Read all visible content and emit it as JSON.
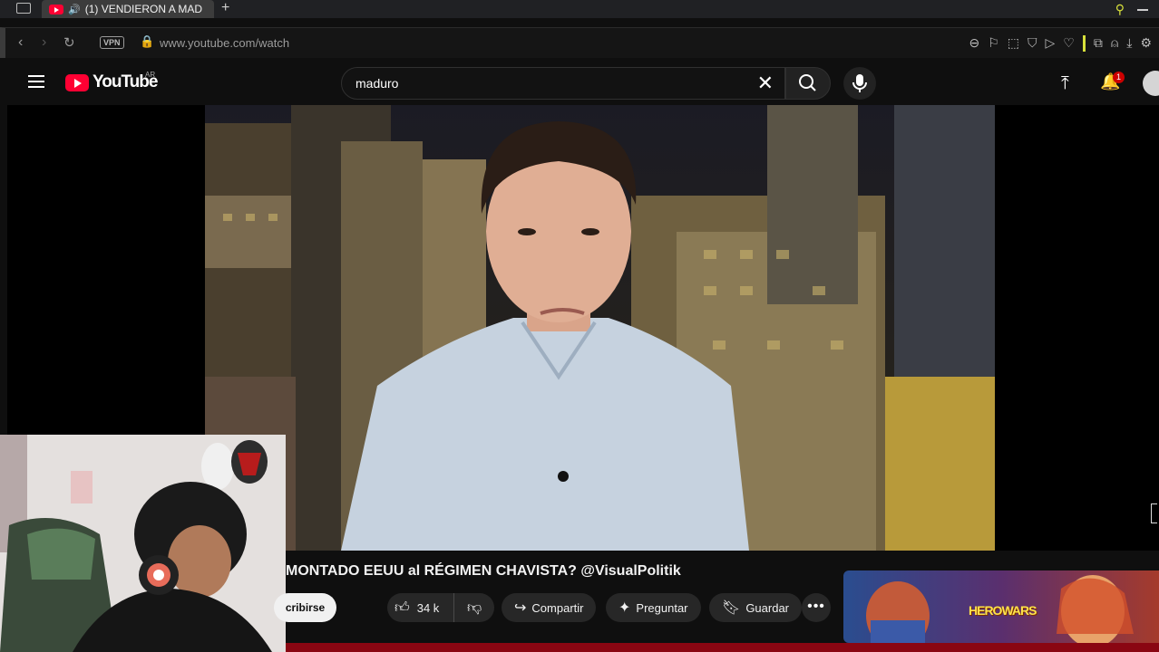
{
  "browser": {
    "tab_title": "(1) VENDIERON A MAD",
    "vpn_label": "VPN",
    "url": "www.youtube.com/watch"
  },
  "header": {
    "logo_text": "YouTube",
    "country": "AR",
    "search_value": "maduro",
    "notification_count": "1"
  },
  "video": {
    "title": "MONTADO EEUU al RÉGIMEN CHAVISTA? @VisualPolitik",
    "subscribe_label": "cribirse",
    "likes": "34 k",
    "share_label": "Compartir",
    "ask_label": "Preguntar",
    "save_label": "Guardar"
  },
  "ad": {
    "brand": "HEROWARS"
  }
}
